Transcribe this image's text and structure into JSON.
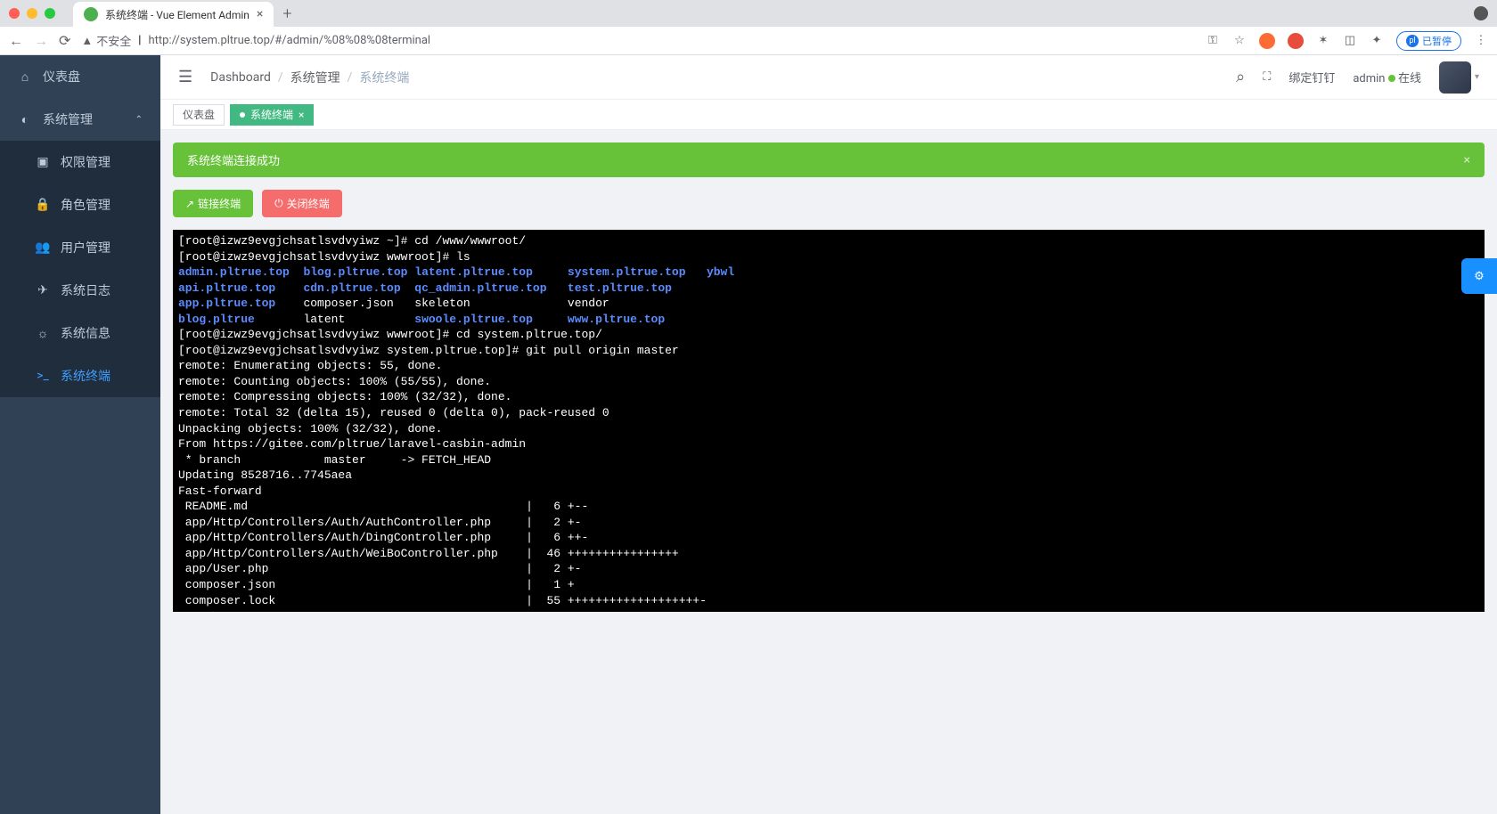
{
  "browser": {
    "tab_title": "系统终端 - Vue Element Admin",
    "url_warning": "不安全",
    "url": "http://system.pltrue.top/#/admin/%08%08%08terminal",
    "paused_label": "已暂停"
  },
  "sidebar": {
    "items": [
      {
        "icon": "dashboard",
        "label": "仪表盘"
      },
      {
        "icon": "gear",
        "label": "系统管理"
      },
      {
        "icon": "shield",
        "label": "权限管理"
      },
      {
        "icon": "lock",
        "label": "角色管理"
      },
      {
        "icon": "users",
        "label": "用户管理"
      },
      {
        "icon": "plane",
        "label": "系统日志"
      },
      {
        "icon": "sun",
        "label": "系统信息"
      },
      {
        "icon": "terminal",
        "label": "系统终端"
      }
    ]
  },
  "breadcrumb": {
    "item1": "Dashboard",
    "item2": "系统管理",
    "item3": "系统终端"
  },
  "header": {
    "dingding": "绑定钉钉",
    "user": "admin",
    "status": "在线"
  },
  "tabs": {
    "inactive": "仪表盘",
    "active": "系统终端"
  },
  "alert": {
    "text": "系统终端连接成功"
  },
  "buttons": {
    "connect": "链接终端",
    "close": "关闭终端"
  },
  "terminal_lines": [
    {
      "t": "prompt",
      "text": "[root@izwz9evgjchsatlsvdvyiwz ~]# cd /www/wwwroot/"
    },
    {
      "t": "prompt",
      "text": "[root@izwz9evgjchsatlsvdvyiwz wwwroot]# ls"
    },
    {
      "t": "ls",
      "cols": [
        [
          "admin.pltrue.top",
          "blue"
        ],
        [
          "blog.pltrue.top",
          "blue"
        ],
        [
          "latent.pltrue.top",
          "blue"
        ],
        [
          "system.pltrue.top",
          "blue"
        ],
        [
          "ybwl",
          "blue"
        ]
      ]
    },
    {
      "t": "ls",
      "cols": [
        [
          "api.pltrue.top",
          "blue"
        ],
        [
          "cdn.pltrue.top",
          "blue"
        ],
        [
          "qc_admin.pltrue.top",
          "blue"
        ],
        [
          "test.pltrue.top",
          "blue"
        ],
        [
          "",
          ""
        ]
      ]
    },
    {
      "t": "ls",
      "cols": [
        [
          "app.pltrue.top",
          "blue"
        ],
        [
          "composer.json",
          "white"
        ],
        [
          "skeleton",
          "white"
        ],
        [
          "vendor",
          "white"
        ],
        [
          "",
          ""
        ]
      ]
    },
    {
      "t": "ls",
      "cols": [
        [
          "blog.pltrue",
          "blue"
        ],
        [
          "latent",
          "white"
        ],
        [
          "swoole.pltrue.top",
          "blue"
        ],
        [
          "www.pltrue.top",
          "blue"
        ],
        [
          "",
          ""
        ]
      ]
    },
    {
      "t": "prompt",
      "text": "[root@izwz9evgjchsatlsvdvyiwz wwwroot]# cd system.pltrue.top/"
    },
    {
      "t": "prompt",
      "text": "[root@izwz9evgjchsatlsvdvyiwz system.pltrue.top]# git pull origin master"
    },
    {
      "t": "plain",
      "text": "remote: Enumerating objects: 55, done."
    },
    {
      "t": "plain",
      "text": "remote: Counting objects: 100% (55/55), done."
    },
    {
      "t": "plain",
      "text": "remote: Compressing objects: 100% (32/32), done."
    },
    {
      "t": "plain",
      "text": "remote: Total 32 (delta 15), reused 0 (delta 0), pack-reused 0"
    },
    {
      "t": "plain",
      "text": "Unpacking objects: 100% (32/32), done."
    },
    {
      "t": "plain",
      "text": "From https://gitee.com/pltrue/laravel-casbin-admin"
    },
    {
      "t": "plain",
      "text": " * branch            master     -> FETCH_HEAD"
    },
    {
      "t": "plain",
      "text": "Updating 8528716..7745aea"
    },
    {
      "t": "plain",
      "text": "Fast-forward"
    },
    {
      "t": "plain",
      "text": " README.md                                        |   6 +--"
    },
    {
      "t": "plain",
      "text": " app/Http/Controllers/Auth/AuthController.php     |   2 +-"
    },
    {
      "t": "plain",
      "text": " app/Http/Controllers/Auth/DingController.php     |   6 ++-"
    },
    {
      "t": "plain",
      "text": " app/Http/Controllers/Auth/WeiBoController.php    |  46 ++++++++++++++++"
    },
    {
      "t": "plain",
      "text": " app/User.php                                     |   2 +-"
    },
    {
      "t": "plain",
      "text": " composer.json                                    |   1 +"
    },
    {
      "t": "plain",
      "text": " composer.lock                                    |  55 +++++++++++++++++++-"
    }
  ]
}
